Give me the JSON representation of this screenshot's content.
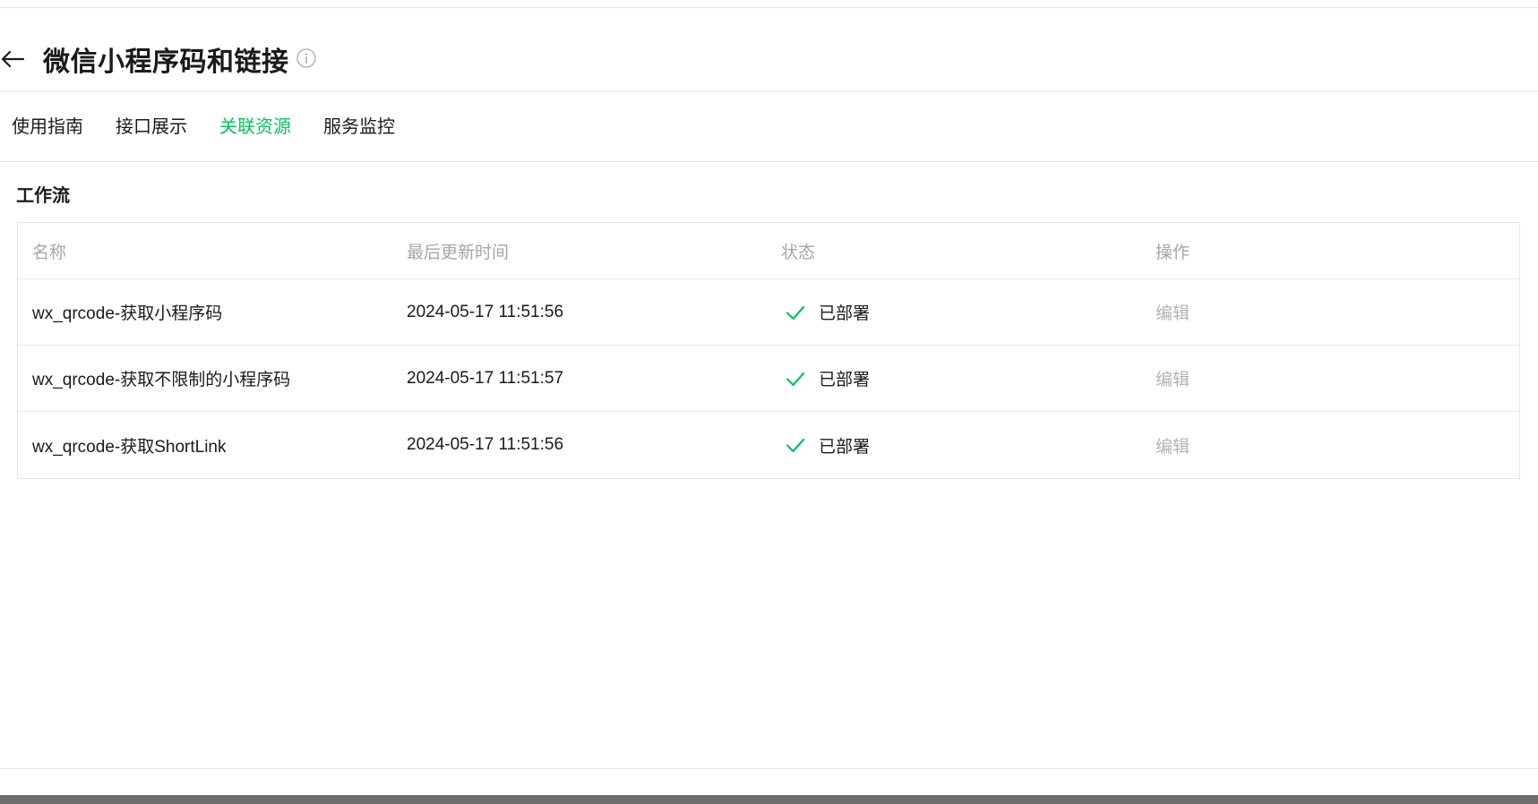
{
  "header": {
    "title": "微信小程序码和链接",
    "back_icon": "arrow-left-icon",
    "info_icon": "info-circle-icon"
  },
  "tabs": [
    {
      "label": "使用指南",
      "active": false
    },
    {
      "label": "接口展示",
      "active": false
    },
    {
      "label": "关联资源",
      "active": true
    },
    {
      "label": "服务监控",
      "active": false
    }
  ],
  "section": {
    "title": "工作流"
  },
  "table": {
    "columns": [
      "名称",
      "最后更新时间",
      "状态",
      "操作"
    ],
    "rows": [
      {
        "name": "wx_qrcode-获取小程序码",
        "updated": "2024-05-17 11:51:56",
        "status": "已部署",
        "action": "编辑"
      },
      {
        "name": "wx_qrcode-获取不限制的小程序码",
        "updated": "2024-05-17 11:51:57",
        "status": "已部署",
        "action": "编辑"
      },
      {
        "name": "wx_qrcode-获取ShortLink",
        "updated": "2024-05-17 11:51:56",
        "status": "已部署",
        "action": "编辑"
      }
    ]
  },
  "colors": {
    "accent": "#07c160",
    "muted": "#a6a6a6",
    "border": "#e7e7e7"
  }
}
